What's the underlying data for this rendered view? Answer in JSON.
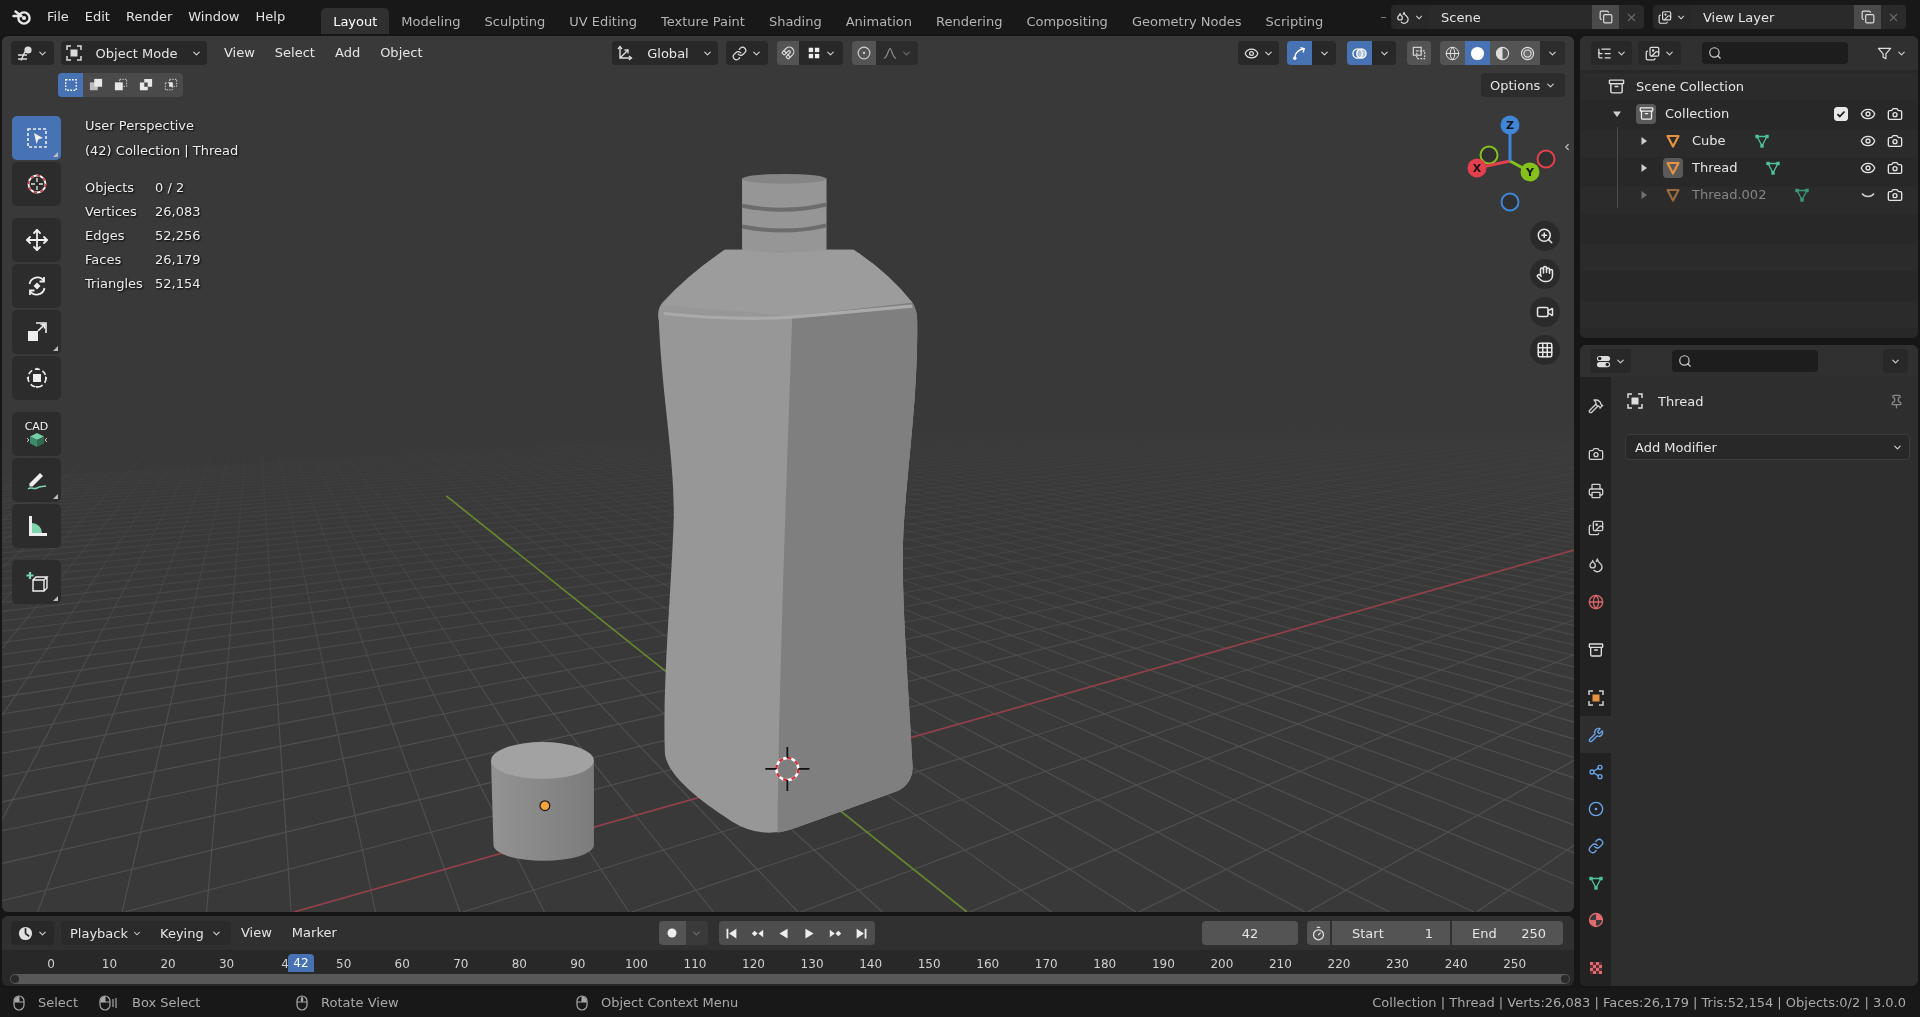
{
  "topbar": {
    "menus": [
      "File",
      "Edit",
      "Render",
      "Window",
      "Help"
    ],
    "workspaces": [
      {
        "label": "Layout",
        "selected": true
      },
      {
        "label": "Modeling",
        "selected": false
      },
      {
        "label": "Sculpting",
        "selected": false
      },
      {
        "label": "UV Editing",
        "selected": false
      },
      {
        "label": "Texture Paint",
        "selected": false
      },
      {
        "label": "Shading",
        "selected": false
      },
      {
        "label": "Animation",
        "selected": false
      },
      {
        "label": "Rendering",
        "selected": false
      },
      {
        "label": "Compositing",
        "selected": false
      },
      {
        "label": "Geometry Nodes",
        "selected": false
      },
      {
        "label": "Scripting",
        "selected": false
      }
    ],
    "scene": "Scene",
    "view_layer": "View Layer"
  },
  "viewport": {
    "mode": "Object Mode",
    "menus": [
      "View",
      "Select",
      "Add",
      "Object"
    ],
    "orientation": "Global",
    "snap": {
      "on": false
    },
    "proportional_editing": {
      "on": false
    },
    "gizmos": {
      "on": true
    },
    "overlays": {
      "on": true
    },
    "xray": {
      "on": false
    },
    "shading": [
      {
        "kind": "wireframe",
        "selected": false
      },
      {
        "kind": "solid",
        "selected": true
      },
      {
        "kind": "material",
        "selected": false
      },
      {
        "kind": "rendered",
        "selected": false
      }
    ],
    "select_modes": [
      {
        "kind": "set",
        "selected": true
      },
      {
        "kind": "extend",
        "selected": false
      },
      {
        "kind": "subtract",
        "selected": false
      },
      {
        "kind": "difference",
        "selected": false
      },
      {
        "kind": "intersect",
        "selected": false
      }
    ],
    "options": "Options",
    "tool_groups": [
      [
        {
          "kind": "select_box",
          "selected": true,
          "more": true
        },
        {
          "kind": "cursor",
          "selected": false,
          "more": false
        }
      ],
      [
        {
          "kind": "move",
          "selected": false,
          "more": false
        },
        {
          "kind": "rotate",
          "selected": false,
          "more": false
        },
        {
          "kind": "scale",
          "selected": false,
          "more": true
        },
        {
          "kind": "transform",
          "selected": false,
          "more": false
        }
      ],
      [
        {
          "kind": "cad",
          "label": "CAD",
          "selected": false,
          "more": false
        },
        {
          "kind": "annotate",
          "selected": false,
          "more": true
        },
        {
          "kind": "measure",
          "selected": false,
          "more": false
        }
      ],
      [
        {
          "kind": "add_cube",
          "selected": false,
          "more": true
        }
      ]
    ],
    "view_name": "User Perspective",
    "context": "(42) Collection | Thread",
    "stats": [
      {
        "label": "Objects",
        "value": "0 / 2"
      },
      {
        "label": "Vertices",
        "value": "26,083"
      },
      {
        "label": "Edges",
        "value": "52,256"
      },
      {
        "label": "Faces",
        "value": "26,179"
      },
      {
        "label": "Triangles",
        "value": "52,154"
      }
    ],
    "gizmo_axes": [
      {
        "label": "X",
        "color": "#e2404c"
      },
      {
        "label": "Y",
        "color": "#84c11c"
      },
      {
        "label": "Z",
        "color": "#3e86d8"
      }
    ]
  },
  "outliner": {
    "root": "Scene Collection",
    "collections": [
      {
        "name": "Collection",
        "expanded": true,
        "checked": true,
        "active": true,
        "children": [
          {
            "name": "Cube",
            "expanded": false,
            "active": false,
            "hidden": false
          },
          {
            "name": "Thread",
            "expanded": false,
            "active": true,
            "hidden": false
          },
          {
            "name": "Thread.002",
            "expanded": false,
            "active": false,
            "hidden": true
          }
        ]
      }
    ]
  },
  "properties": {
    "tab_groups": [
      [
        {
          "kind": "tool",
          "selected": false
        }
      ],
      [
        {
          "kind": "render",
          "selected": false
        },
        {
          "kind": "output",
          "selected": false
        },
        {
          "kind": "view_layer",
          "selected": false
        },
        {
          "kind": "scene",
          "selected": false
        },
        {
          "kind": "world",
          "selected": false
        }
      ],
      [
        {
          "kind": "collection",
          "selected": false
        }
      ],
      [
        {
          "kind": "object",
          "selected": false
        },
        {
          "kind": "modifiers",
          "selected": true
        },
        {
          "kind": "particles",
          "selected": false
        },
        {
          "kind": "physics",
          "selected": false
        },
        {
          "kind": "constraints",
          "selected": false
        },
        {
          "kind": "data",
          "selected": false
        },
        {
          "kind": "material",
          "selected": false
        }
      ],
      [
        {
          "kind": "texture",
          "selected": false
        }
      ]
    ],
    "object_name": "Thread",
    "add_modifier": "Add Modifier"
  },
  "timeline": {
    "menus": [
      {
        "label": "Playback",
        "kind": "dropdown"
      },
      {
        "label": "Keying",
        "kind": "dropdown"
      },
      {
        "label": "View",
        "kind": "menu"
      },
      {
        "label": "Marker",
        "kind": "menu"
      }
    ],
    "transport": [
      {
        "kind": "jump_start"
      },
      {
        "kind": "prev_key"
      },
      {
        "kind": "play_reverse"
      },
      {
        "kind": "play"
      },
      {
        "kind": "next_key"
      },
      {
        "kind": "jump_end"
      }
    ],
    "current_frame": "42",
    "start_label": "Start",
    "start": "1",
    "end_label": "End",
    "end": "250",
    "ruler": [
      "0",
      "10",
      "20",
      "30",
      "4",
      "50",
      "60",
      "70",
      "80",
      "90",
      "100",
      "110",
      "120",
      "130",
      "140",
      "150",
      "160",
      "170",
      "180",
      "190",
      "200",
      "210",
      "220",
      "230",
      "240",
      "250"
    ],
    "playhead": {
      "label": "42",
      "level": 0.168
    }
  },
  "status_bar": {
    "hints": [
      {
        "kind": "left",
        "label": "Select"
      },
      {
        "kind": "drag",
        "label": "Box Select"
      },
      {
        "kind": "middle",
        "label": "Rotate View"
      },
      {
        "kind": "right",
        "label": "Object Context Menu"
      }
    ],
    "info": "Collection | Thread | Verts:26,083 | Faces:26,179 | Tris:52,154 | Objects:0/2 | 3.0.0"
  }
}
